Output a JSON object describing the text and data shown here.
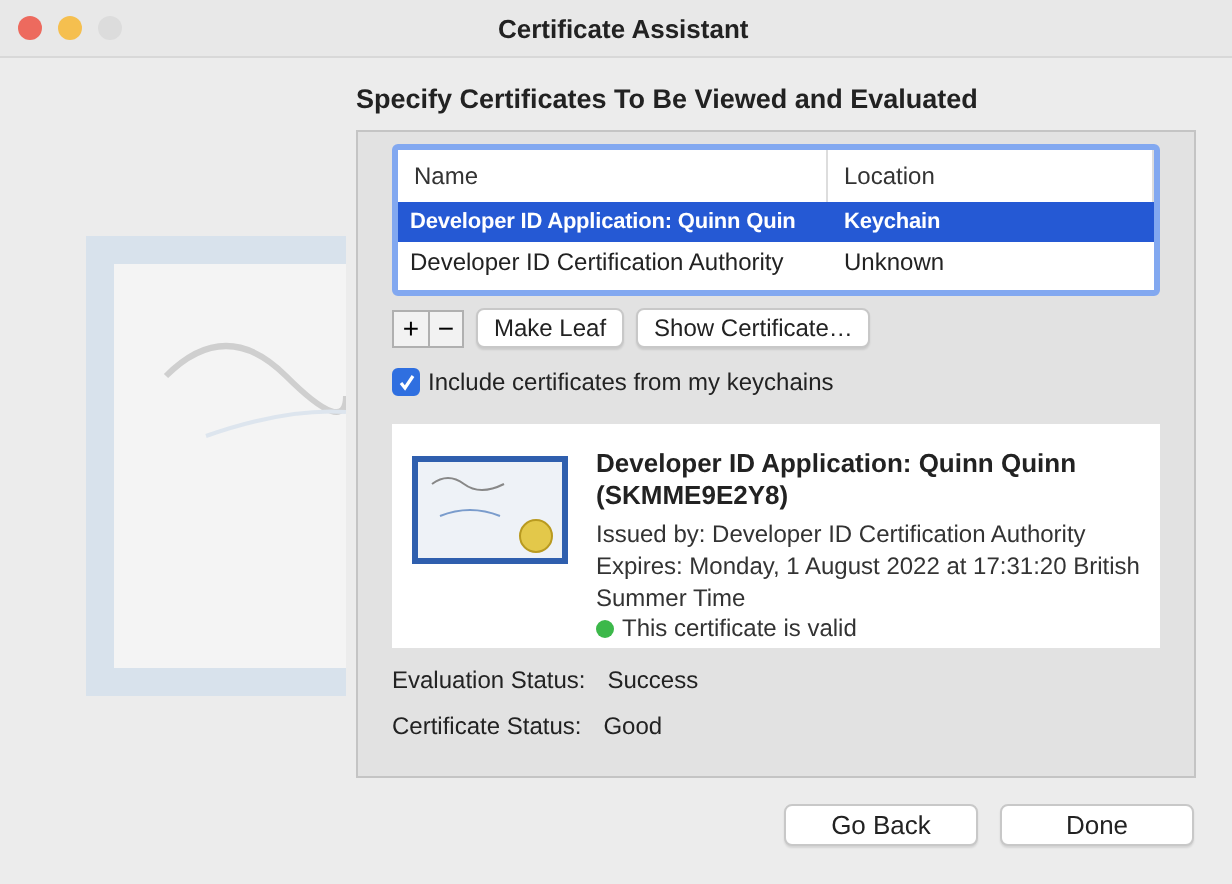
{
  "window": {
    "title": "Certificate Assistant"
  },
  "heading": "Specify Certificates To Be Viewed and Evaluated",
  "table": {
    "columns": [
      "Name",
      "Location"
    ],
    "rows": [
      {
        "name": "Developer ID Application: Quinn Quin",
        "location": "Keychain",
        "selected": true
      },
      {
        "name": "Developer ID Certification Authority",
        "location": "Unknown",
        "selected": false
      }
    ]
  },
  "tools": {
    "add": "+",
    "remove": "−",
    "buttons": [
      "Make Leaf",
      "Show Certificate…"
    ]
  },
  "include_checkbox": {
    "label": "Include certificates from my keychains",
    "checked": true
  },
  "certificate": {
    "title": "Developer ID Application: Quinn Quinn (SKMME9E2Y8)",
    "issued_by": "Issued by: Developer ID Certification Authority",
    "expires": "Expires: Monday, 1 August 2022 at 17:31:20 British Summer Time",
    "validity": "This certificate is valid"
  },
  "statuses": [
    {
      "label": "Evaluation Status:",
      "value": "Success"
    },
    {
      "label": "Certificate Status:",
      "value": "Good"
    }
  ],
  "buttons": [
    "Go Back",
    "Done"
  ]
}
